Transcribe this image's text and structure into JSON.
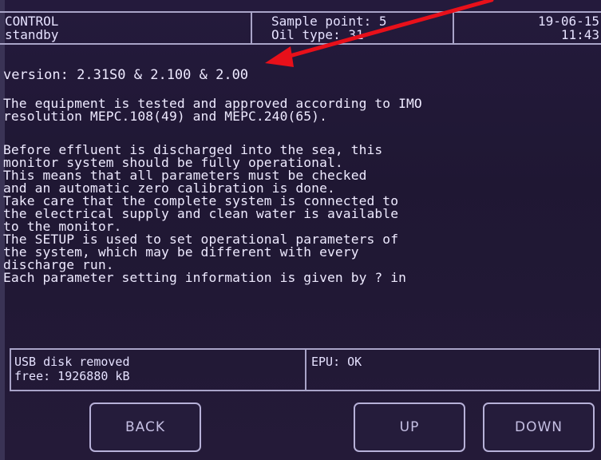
{
  "header": {
    "mode": "CONTROL",
    "state": "standby",
    "sample_point": "Sample point: 5",
    "oil_type": "Oil type: 31",
    "date": "19-06-15",
    "time": "11:43"
  },
  "version_line": "version: 2.31S0 & 2.100 & 2.00",
  "approval_text": [
    "The equipment is tested and approved according to IMO",
    "resolution MEPC.108(49) and MEPC.240(65)."
  ],
  "info_text": [
    "Before effluent is discharged into the sea, this",
    "monitor system should be fully operational.",
    "This means that all parameters must be checked",
    "and an automatic zero calibration is done.",
    "Take care that the complete system is connected to",
    "the electrical supply and clean water is available",
    "to the monitor.",
    "The SETUP is used to set operational parameters of",
    "the system, which may be different with every",
    "discharge run.",
    "Each parameter setting information is given by ? in"
  ],
  "status": {
    "usb": "USB disk removed",
    "free": "free: 1926880 kB",
    "epu": "EPU: OK"
  },
  "buttons": {
    "back": "BACK",
    "up": "UP",
    "down": "DOWN"
  },
  "colors": {
    "background": "#211832",
    "text": "#eeeaff",
    "border": "#a9a4c8",
    "arrow": "#e8101a"
  }
}
